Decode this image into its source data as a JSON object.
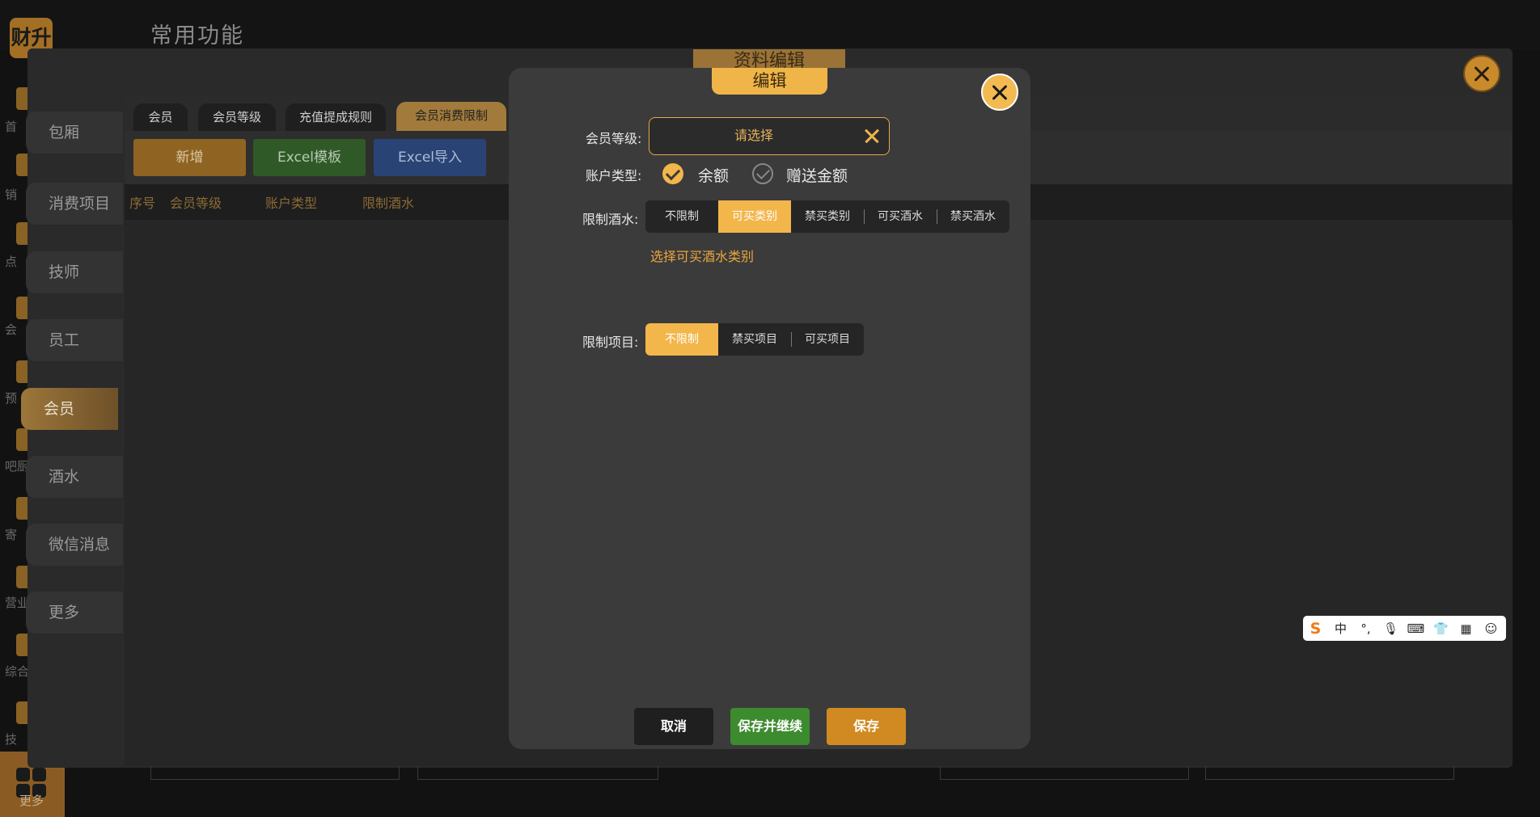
{
  "background": {
    "title": "常用功能",
    "logo_text": "财升",
    "rail_labels": [
      "首",
      "销",
      "点",
      "会",
      "预",
      "吧厨",
      "寄",
      "营业",
      "综合",
      "技"
    ],
    "more_label": "更多"
  },
  "main_dialog": {
    "title": "资料编辑",
    "nav": [
      "包厢",
      "消费项目",
      "技师",
      "员工",
      "会员",
      "酒水",
      "微信消息",
      "更多"
    ],
    "nav_active": "会员",
    "tabs": [
      "会员",
      "会员等级",
      "充值提成规则",
      "会员消费限制"
    ],
    "tab_active": "会员消费限制",
    "toolbar": {
      "add_label": "新增",
      "excel_template_label": "Excel模板",
      "excel_import_label": "Excel导入"
    },
    "columns": [
      "序号",
      "会员等级",
      "账户类型",
      "限制酒水"
    ]
  },
  "edit_modal": {
    "title": "编辑",
    "member_level": {
      "label": "会员等级:",
      "placeholder": "请选择"
    },
    "account_type": {
      "label": "账户类型:",
      "options": [
        {
          "label": "余额",
          "checked": true
        },
        {
          "label": "赠送金额",
          "checked": false
        }
      ]
    },
    "limit_drinks": {
      "label": "限制酒水:",
      "options": [
        "不限制",
        "可买类别",
        "禁买类别",
        "可买酒水",
        "禁买酒水"
      ],
      "selected": "可买类别",
      "select_link": "选择可买酒水类别"
    },
    "limit_items": {
      "label": "限制项目:",
      "options": [
        "不限制",
        "禁买项目",
        "可买项目"
      ],
      "selected": "不限制"
    },
    "buttons": {
      "cancel": "取消",
      "save_continue": "保存并继续",
      "save": "保存"
    }
  },
  "ime_toolbar": {
    "logo": "S",
    "mode": "中",
    "icons": [
      "punctuation-icon",
      "microphone-icon",
      "keyboard-icon",
      "skin-icon",
      "grid-icon",
      "emoji-icon"
    ]
  },
  "colors": {
    "accent": "#f2b64b",
    "gold_dark": "#a27a3b",
    "green": "#3c8b2e",
    "blue": "#2b4f95",
    "orange_button": "#d08a21"
  }
}
